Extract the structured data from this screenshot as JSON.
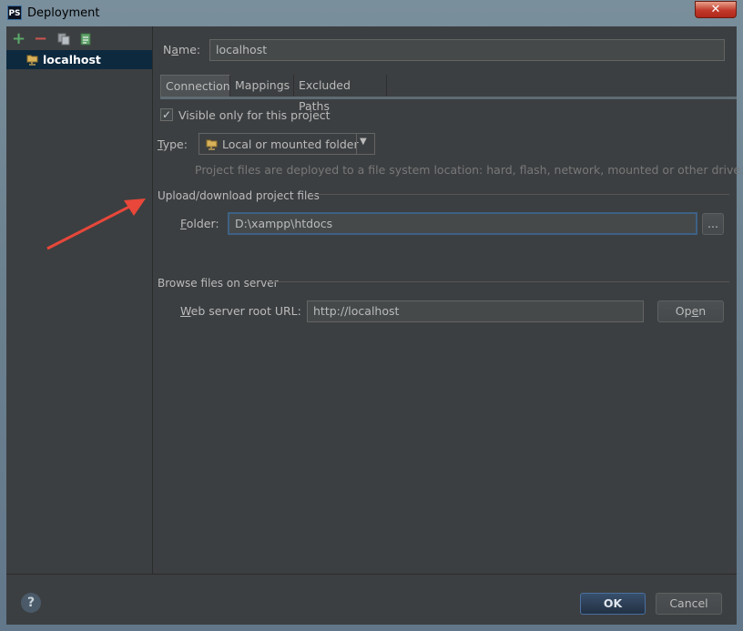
{
  "window": {
    "title": "Deployment",
    "app_icon": "PS",
    "close_glyph": "✕"
  },
  "toolbar": {
    "add_glyph": "+",
    "remove_glyph": "−"
  },
  "tree": {
    "items": [
      {
        "label": "localhost",
        "icon": "server-folder-icon"
      }
    ]
  },
  "name": {
    "label": "Name:",
    "value": "localhost"
  },
  "tabs": [
    "Connection",
    "Mappings",
    "Excluded Paths"
  ],
  "connection": {
    "visible_only": {
      "label": "Visible only for this project",
      "checked": true
    },
    "type": {
      "label": "Type:",
      "value": "Local or mounted folder"
    },
    "type_hint": "Project files are deployed to a file system location: hard, flash, network, mounted or other drive.",
    "upload": {
      "title": "Upload/download project files",
      "folder_label": "Folder:",
      "folder_value": "D:\\xampp\\htdocs",
      "browse_label": "..."
    },
    "browse": {
      "title": "Browse files on server",
      "url_label": "Web server root URL:",
      "url_value": "http://localhost",
      "open_label": "Open"
    }
  },
  "footer": {
    "help_glyph": "?",
    "ok_label": "OK",
    "cancel_label": "Cancel"
  },
  "colors": {
    "accent_arrow": "#e8473a",
    "selection": "#0d293e",
    "add": "#59a869",
    "remove": "#c75450"
  }
}
